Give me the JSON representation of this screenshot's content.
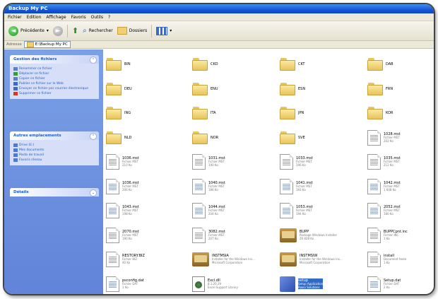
{
  "window": {
    "title": "Backup My PC"
  },
  "menu": [
    "Fichier",
    "Edition",
    "Affichage",
    "Favoris",
    "Outils",
    "?"
  ],
  "toolbar": {
    "back": "Précédente",
    "search": "Rechercher",
    "folders": "Dossiers"
  },
  "address": {
    "label": "Adresse",
    "path": "E:\\Backup My PC"
  },
  "sidebar": {
    "panels": [
      {
        "title": "Gestion des fichiers",
        "tasks": [
          "Renommer ce fichier",
          "Déplacer ce fichier",
          "Copier ce fichier",
          "Publier ce fichier sur le Web",
          "Envoyer ce fichier par courrier électronique",
          "Supprimer ce fichier"
        ]
      },
      {
        "title": "Autres emplacements",
        "tasks": [
          "Drive (E:)",
          "Mes documents",
          "Poste de travail",
          "Favoris réseau"
        ]
      },
      {
        "title": "Détails",
        "tasks": []
      }
    ]
  },
  "files": [
    {
      "name": "BIN",
      "type": "folder"
    },
    {
      "name": "CKD",
      "type": "folder"
    },
    {
      "name": "CKT",
      "type": "folder"
    },
    {
      "name": "DAB",
      "type": "folder"
    },
    {
      "name": "DEU",
      "type": "folder"
    },
    {
      "name": "ENU",
      "type": "folder"
    },
    {
      "name": "ESN",
      "type": "folder"
    },
    {
      "name": "FRN",
      "type": "folder"
    },
    {
      "name": "ING",
      "type": "folder"
    },
    {
      "name": "ITA",
      "type": "folder"
    },
    {
      "name": "JPN",
      "type": "folder"
    },
    {
      "name": "KOR",
      "type": "folder"
    },
    {
      "name": "NLD",
      "type": "folder"
    },
    {
      "name": "NOR",
      "type": "folder"
    },
    {
      "name": "SVE",
      "type": "folder"
    },
    {
      "name": "1028.mst",
      "type": "file",
      "meta1": "Fichier MST",
      "meta2": "202 Ko"
    },
    {
      "name": "1036.mst",
      "type": "file",
      "meta1": "Fichier MST",
      "meta2": "210 Ko"
    },
    {
      "name": "1031.mst",
      "type": "file",
      "meta1": "Fichier MST",
      "meta2": "190 Ko"
    },
    {
      "name": "1033.mst",
      "type": "file",
      "meta1": "Fichier MST",
      "meta2": "196 Ko"
    },
    {
      "name": "1035.mst",
      "type": "file",
      "meta1": "Fichier MST",
      "meta2": "212 Ko"
    },
    {
      "name": "1036.mst",
      "type": "file",
      "meta1": "Fichier MST",
      "meta2": "206 Ko"
    },
    {
      "name": "1040.mst",
      "type": "file",
      "meta1": "Fichier MST",
      "meta2": "186 Ko"
    },
    {
      "name": "1041.mst",
      "type": "file",
      "meta1": "Fichier MST",
      "meta2": "192 Ko"
    },
    {
      "name": "1042.mst",
      "type": "file",
      "meta1": "Fichier MST",
      "meta2": "1 608 Ko"
    },
    {
      "name": "1043.mst",
      "type": "file",
      "meta1": "Fichier MST",
      "meta2": "198 Ko"
    },
    {
      "name": "1044.mst",
      "type": "file",
      "meta1": "Fichier MST",
      "meta2": "204 Ko"
    },
    {
      "name": "1053.mst",
      "type": "file",
      "meta1": "Fichier MST",
      "meta2": "194 Ko"
    },
    {
      "name": "2052.mst",
      "type": "file",
      "meta1": "Fichier MST",
      "meta2": "180 Ko"
    },
    {
      "name": "2070.mst",
      "type": "file",
      "meta1": "Fichier MST",
      "meta2": "190 Ko"
    },
    {
      "name": "3082.mst",
      "type": "file",
      "meta1": "Fichier MST",
      "meta2": "207 Ko"
    },
    {
      "name": "BUPP",
      "type": "pkg",
      "meta1": "Package Windows Installer",
      "meta2": "26 828 Ko"
    },
    {
      "name": "BUPPCpnt.inc",
      "type": "file",
      "meta1": "Fichier INC",
      "meta2": "1 Ko"
    },
    {
      "name": "RESTORY.BIZ",
      "type": "file",
      "meta1": "Fichier BIZ",
      "meta2": "40 Ko"
    },
    {
      "name": "INSTMSIA",
      "type": "pkg",
      "meta1": "Installer for the Windows Ins...",
      "meta2": "Microsoft Corporation"
    },
    {
      "name": "INSTMSIW",
      "type": "pkg",
      "meta1": "Installer for the Windows Ins...",
      "meta2": "Microsoft Corporation"
    },
    {
      "name": "install",
      "type": "file",
      "meta1": "Document texte",
      "meta2": "1 Ko"
    },
    {
      "name": "psconfig.dat",
      "type": "file",
      "meta1": "Fichier DAT",
      "meta2": "1 Ko"
    },
    {
      "name": "Excl.dll",
      "type": "dll",
      "meta1": "8.1.20.29",
      "meta2": "Excel Support Library"
    },
    {
      "name": "setup",
      "type": "exe",
      "meta1": "Setup Application",
      "meta2": "Roxio Solutions",
      "selected": true
    },
    {
      "name": "Setup.dat",
      "type": "file",
      "meta1": "Fichier DAT",
      "meta2": "2 Ko"
    }
  ]
}
